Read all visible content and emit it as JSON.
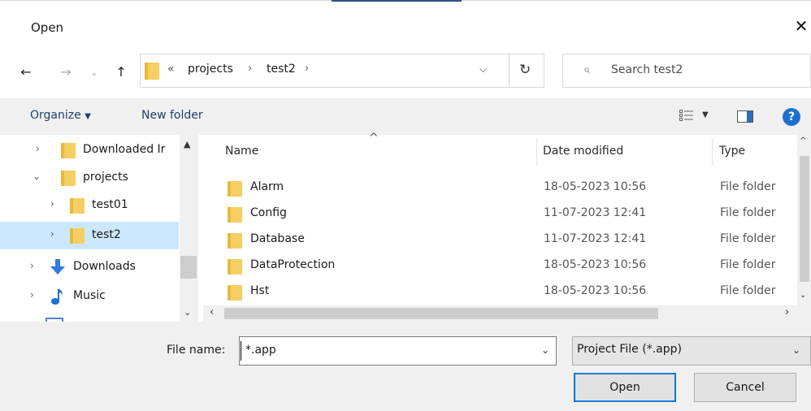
{
  "window": {
    "title": "Open"
  },
  "nav": {
    "address": {
      "overflow": "«",
      "crumbs": [
        "projects",
        "test2"
      ]
    },
    "search_placeholder": "Search test2"
  },
  "toolbar": {
    "organize": "Organize",
    "new_folder": "New folder"
  },
  "tree": [
    {
      "label": "Downloaded Ir",
      "icon": "folder-icon",
      "expanded": false,
      "selected": false
    },
    {
      "label": "projects",
      "icon": "folder-icon",
      "expanded": true,
      "selected": false
    },
    {
      "label": "test01",
      "icon": "folder-icon",
      "expanded": false,
      "selected": false
    },
    {
      "label": "test2",
      "icon": "folder-icon",
      "expanded": false,
      "selected": true
    },
    {
      "label": "Downloads",
      "icon": "download-icon",
      "expanded": false,
      "selected": false
    },
    {
      "label": "Music",
      "icon": "music-icon",
      "expanded": false,
      "selected": false
    }
  ],
  "columns": {
    "name": "Name",
    "date": "Date modified",
    "type": "Type"
  },
  "files": [
    {
      "name": "Alarm",
      "date": "18-05-2023 10:56",
      "type": "File folder"
    },
    {
      "name": "Config",
      "date": "11-07-2023 12:41",
      "type": "File folder"
    },
    {
      "name": "Database",
      "date": "11-07-2023 12:41",
      "type": "File folder"
    },
    {
      "name": "DataProtection",
      "date": "18-05-2023 10:56",
      "type": "File folder"
    },
    {
      "name": "Hst",
      "date": "18-05-2023 10:56",
      "type": "File folder"
    }
  ],
  "bottom": {
    "file_name_label": "File name:",
    "file_name_value": "*.app",
    "filter_value": "Project File (*.app)",
    "open": "Open",
    "cancel": "Cancel"
  },
  "colors": {
    "accent": "#0078d7",
    "selection": "#cce8ff",
    "folder": "#f5cf63",
    "link": "#1e3f6b"
  }
}
